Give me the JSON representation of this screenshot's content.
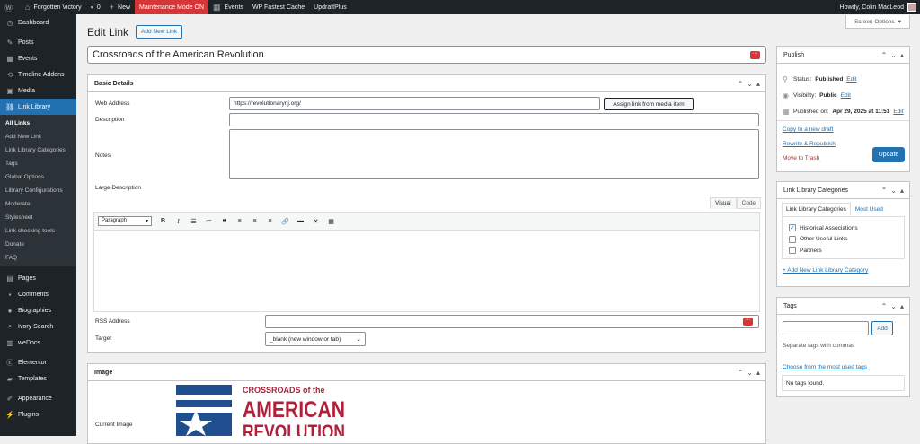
{
  "adminbar": {
    "site_name": "Forgotten Victory",
    "comments_count": "0",
    "new_label": "New",
    "maintenance": "Maintenance Mode ON",
    "events": "Events",
    "cache": "WP Fastest Cache",
    "updraft": "UpdraftPlus",
    "howdy": "Howdy, Colin MacLeod"
  },
  "sidebar": {
    "items_top": [
      {
        "label": "Dashboard",
        "icon": "dashboard-icon"
      }
    ],
    "items_mid": [
      {
        "label": "Posts",
        "icon": "pin-icon"
      },
      {
        "label": "Events",
        "icon": "calendar-icon"
      },
      {
        "label": "Timeline Addons",
        "icon": "timeline-icon"
      },
      {
        "label": "Media",
        "icon": "media-icon"
      },
      {
        "label": "Link Library",
        "icon": "link-icon"
      }
    ],
    "submenu": [
      "All Links",
      "Add New Link",
      "Link Library Categories",
      "Tags",
      "Global Options",
      "Library Configurations",
      "Moderate",
      "Stylesheet",
      "Link checking tools",
      "Donate",
      "FAQ"
    ],
    "items_bottom": [
      {
        "label": "Pages",
        "icon": "pages-icon"
      },
      {
        "label": "Comments",
        "icon": "comments-icon"
      },
      {
        "label": "Biographies",
        "icon": "user-icon"
      },
      {
        "label": "Ivory Search",
        "icon": "search-icon"
      },
      {
        "label": "weDocs",
        "icon": "docs-icon"
      }
    ],
    "items_bottom2": [
      {
        "label": "Elementor",
        "icon": "elementor-icon"
      },
      {
        "label": "Templates",
        "icon": "folder-icon"
      }
    ],
    "items_bottom3": [
      {
        "label": "Appearance",
        "icon": "brush-icon"
      },
      {
        "label": "Plugins",
        "icon": "plugin-icon"
      }
    ]
  },
  "screen_options": "Screen Options",
  "page": {
    "title": "Edit Link",
    "add_new": "Add New Link",
    "link_title": "Crossroads of the American Revolution"
  },
  "basic_details": {
    "heading": "Basic Details",
    "web_address_label": "Web Address",
    "web_address_value": "https://revolutionarynj.org/",
    "assign_button": "Assign link from media item",
    "description_label": "Description",
    "notes_label": "Notes",
    "large_description_label": "Large Description",
    "tab_visual": "Visual",
    "tab_code": "Code",
    "format_select": "Paragraph",
    "rss_label": "RSS Address",
    "target_label": "Target",
    "target_value": "_blank (new window or tab)"
  },
  "image_box": {
    "heading": "Image",
    "current_image_label": "Current Image",
    "logo_line1": "CROSSROADS of the",
    "logo_line2": "AMERICAN",
    "logo_line3": "REVOLUTION"
  },
  "publish": {
    "heading": "Publish",
    "status_label": "Status:",
    "status_value": "Published",
    "visibility_label": "Visibility:",
    "visibility_value": "Public",
    "published_on": "Published on:",
    "published_date": "Apr 29, 2025 at 11:51",
    "edit": "Edit",
    "copy_draft": "Copy to a new draft",
    "rewrite": "Rewrite & Republish",
    "trash": "Move to Trash",
    "update": "Update"
  },
  "categories": {
    "heading": "Link Library Categories",
    "tab_all": "Link Library Categories",
    "tab_used": "Most Used",
    "items": [
      {
        "label": "Historical Associations",
        "checked": true
      },
      {
        "label": "Other Useful Links",
        "checked": false
      },
      {
        "label": "Partners",
        "checked": false
      }
    ],
    "add_new": "+ Add New Link Library Category"
  },
  "tags": {
    "heading": "Tags",
    "add_button": "Add",
    "hint": "Separate tags with commas",
    "choose": "Choose from the most used tags",
    "none": "No tags found."
  }
}
